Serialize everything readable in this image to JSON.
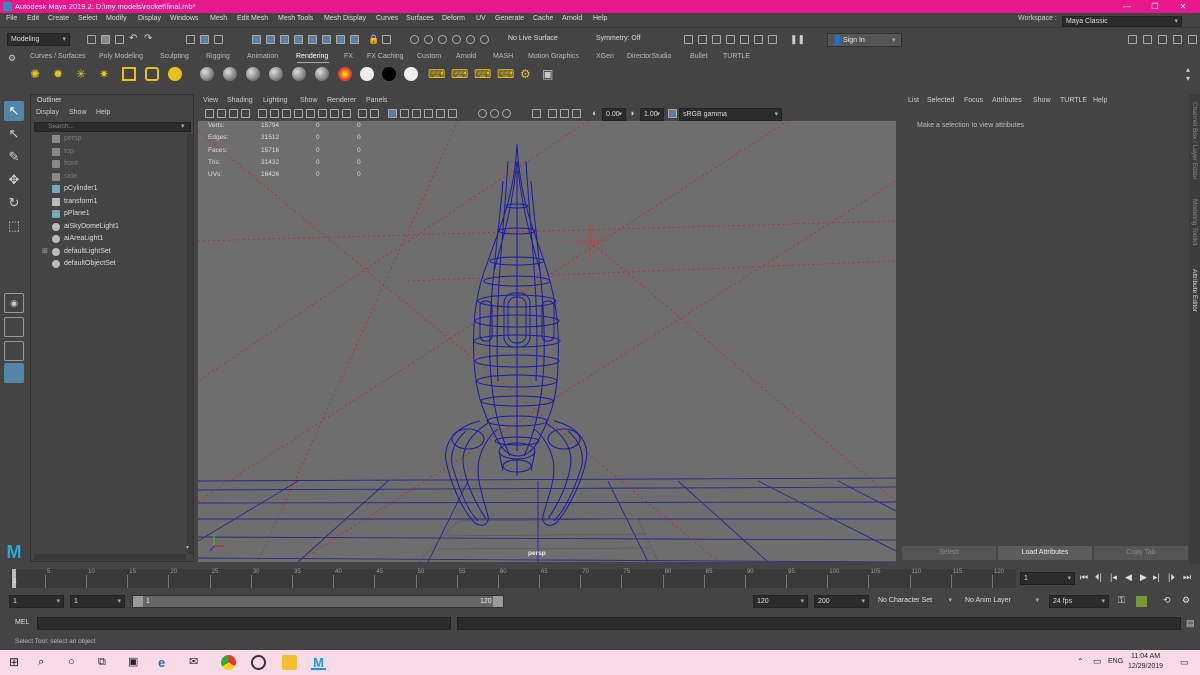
{
  "window": {
    "title": "Autodesk Maya 2019.2: D:\\my models\\rocket\\final.mb*"
  },
  "menus": [
    "File",
    "Edit",
    "Create",
    "Select",
    "Modify",
    "Display",
    "Windows",
    "Mesh",
    "Edit Mesh",
    "Mesh Tools",
    "Mesh Display",
    "Curves",
    "Surfaces",
    "Deform",
    "UV",
    "Generate",
    "Cache",
    "Arnold",
    "Help"
  ],
  "workspace": {
    "label": "Workspace :",
    "value": "Maya Classic"
  },
  "status": {
    "mode": "Modeling",
    "live_surface": "No Live Surface",
    "symmetry": "Symmetry: Off",
    "sign_in": "Sign In"
  },
  "shelf_tabs": [
    "Curves / Surfaces",
    "Poly Modeling",
    "Sculpting",
    "Rigging",
    "Animation",
    "Rendering",
    "FX",
    "FX Caching",
    "Custom",
    "Arnold",
    "MASH",
    "Motion Graphics",
    "XGen",
    "DirectorStudio",
    "Bullet",
    "TURTLE"
  ],
  "active_shelf": "Rendering",
  "outliner": {
    "title": "Outliner",
    "menu": [
      "Display",
      "Show",
      "Help"
    ],
    "search_placeholder": "Search...",
    "items": [
      {
        "label": "persp",
        "dim": true,
        "icon": "camera-icon"
      },
      {
        "label": "top",
        "dim": true,
        "icon": "camera-icon"
      },
      {
        "label": "front",
        "dim": true,
        "icon": "camera-icon"
      },
      {
        "label": "side",
        "dim": true,
        "icon": "camera-icon"
      },
      {
        "label": "pCylinder1",
        "dim": false,
        "icon": "mesh-icon"
      },
      {
        "label": "transform1",
        "dim": false,
        "icon": "transform-icon"
      },
      {
        "label": "pPlane1",
        "dim": false,
        "icon": "mesh-icon"
      },
      {
        "label": "aiSkyDomeLight1",
        "dim": false,
        "icon": "light-icon"
      },
      {
        "label": "aiAreaLight1",
        "dim": false,
        "icon": "light-icon"
      },
      {
        "label": "defaultLightSet",
        "dim": false,
        "icon": "set-icon",
        "expandable": true
      },
      {
        "label": "defaultObjectSet",
        "dim": false,
        "icon": "set-icon"
      }
    ]
  },
  "viewport": {
    "menu": [
      "View",
      "Shading",
      "Lighting",
      "Show",
      "Renderer",
      "Panels"
    ],
    "exposure": "0.00",
    "gamma": "1.00",
    "color_space": "sRGB gamma",
    "camera": "persp",
    "hud": [
      {
        "label": "Verts:",
        "v1": "15794",
        "v2": "0",
        "v3": "0"
      },
      {
        "label": "Edges:",
        "v1": "31512",
        "v2": "0",
        "v3": "0"
      },
      {
        "label": "Faces:",
        "v1": "15716",
        "v2": "0",
        "v3": "0"
      },
      {
        "label": "Tris:",
        "v1": "31432",
        "v2": "0",
        "v3": "0"
      },
      {
        "label": "UVs:",
        "v1": "16426",
        "v2": "0",
        "v3": "0"
      }
    ]
  },
  "attribute_editor": {
    "menu": [
      "List",
      "Selected",
      "Focus",
      "Attributes",
      "Show",
      "TURTLE",
      "Help"
    ],
    "message": "Make a selection to view attributes",
    "buttons": [
      "Select",
      "Load Attributes",
      "Copy Tab"
    ]
  },
  "side_tabs": [
    "Channel Box / Layer Editor",
    "Modeling Toolkit",
    "Attribute Editor"
  ],
  "timeline": {
    "ticks": [
      "5",
      "10",
      "15",
      "20",
      "25",
      "30",
      "35",
      "40",
      "45",
      "50",
      "55",
      "60",
      "65",
      "70",
      "75",
      "80",
      "85",
      "90",
      "95",
      "100",
      "105",
      "110",
      "115",
      "120"
    ],
    "current_frame": "1",
    "start_frame_left": "1",
    "range_start": "1",
    "range_inner_start": "1",
    "range_inner_end": "120",
    "range_end": "120",
    "anim_end": "200",
    "character_set": "No Character Set",
    "anim_layer": "No Anim Layer",
    "fps": "24 fps"
  },
  "command": {
    "label": "MEL"
  },
  "help_line": "Select Tool: select an object",
  "taskbar": {
    "lang": "ENG",
    "time": "11:04 AM",
    "date": "12/29/2019"
  }
}
